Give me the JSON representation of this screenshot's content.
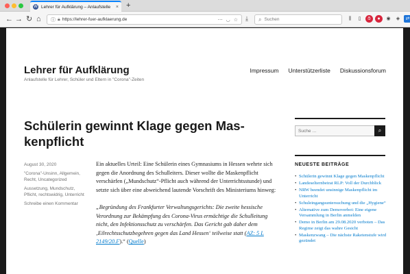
{
  "browser": {
    "tab_title": "Lehrer für Aufklärung – Anlaufstelle",
    "tab_close": "×",
    "new_tab": "+",
    "url": "https://lehrer-fuer-aufklaerung.de",
    "search_placeholder": "Suchen"
  },
  "site": {
    "title": "Lehrer für Aufklärung",
    "description": "Anlaufstelle für Lehrer, Schüler und Eltern in \"Corona\"-Zeiten",
    "nav": [
      "Impressum",
      "Unterstützerliste",
      "Diskussionsforum"
    ]
  },
  "post": {
    "title": "Schülerin gewinnt Klage gegen Mas-kenpflicht",
    "meta": {
      "date": "August 30, 2020",
      "categories": "\"Corona\"-Unsinn, Allgemein, Recht, Uncategorized",
      "tags": "Aussetzung, Mundschutz, Pflicht, rechtswidrig, Unterricht",
      "comment": "Schreibe einen Kommentar"
    },
    "paragraph1": "Ein aktuelles Urteil: Eine Schülerin eines Gymnasiums in Hessen wehrte sich gegen die Anordnung des Schulleiters. Dieser wollte die Maskenpflicht verschärfen („Mundschutz“-Pflicht auch während der Unterrichtsstunde) und setzte sich über eine abweichend lautende Vorschrift des Ministeriums hinweg:",
    "quote_text": "„Begründung des Frankfurter Verwaltungsgerichts: Die zweite hessische Verordnung zur Bekämpfung des Corona-Virus ermächtige die Schulleitung nicht, den Infektionsschutz zu verschärfen. Das Gericht gab daher dem ‚Eilrechtsschutzbegehren gegen das Land Hessen‘ teilweise statt (",
    "quote_link1": "AZ: 5 L 2149/20.F",
    "quote_mid": ").“ (",
    "quote_link2": "Quelle",
    "quote_end": ")"
  },
  "sidebar": {
    "search_placeholder": "Suche …",
    "search_button": "⌕",
    "widget_title": "NEUESTE BEITRÄGE",
    "recent_posts": [
      "Schülerin gewinnt Klage gegen Maskenpflicht",
      "Landeselternbeirat RLP: Voll der Durchblick",
      "NRW beendet unsinnige Maskenpflicht im Unterricht",
      "Schuleingangsuntersuchung und die „Hygiene“",
      "Alternative zum Demoverbot: Eine eigene Versammlung in Berlin anmelden",
      "Demo in Berlin am 29.08.2020 verboten – Das Regime zeigt das wahre Gesicht",
      "Maskenzwang – Die nächste Raketenstufe wird gezündet"
    ]
  }
}
